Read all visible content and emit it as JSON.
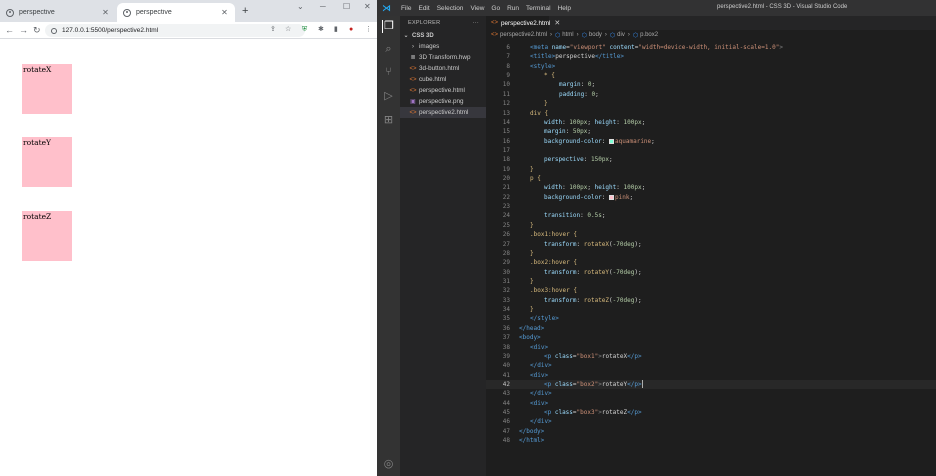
{
  "browser": {
    "tabs": [
      {
        "title": "perspective"
      },
      {
        "title": "perspective"
      }
    ],
    "new_tab": "+",
    "url": "127.0.0.1:5500/perspective2.html",
    "boxes": [
      {
        "label": "rotateX",
        "color": "#ffc0cb"
      },
      {
        "label": "rotateY",
        "color": "#ffc0cb"
      },
      {
        "label": "rotateZ",
        "color": "#ffc0cb"
      }
    ]
  },
  "vscode": {
    "menu": [
      "File",
      "Edit",
      "Selection",
      "View",
      "Go",
      "Run",
      "Terminal",
      "Help"
    ],
    "window_title": "perspective2.html - CSS 3D - Visual Studio Code",
    "explorer_title": "EXPLORER",
    "explorer_more": "···",
    "root_folder": "CSS 3D",
    "files": [
      {
        "name": "images",
        "icon": "folder-icon"
      },
      {
        "name": "3D Transform.hwp",
        "icon": "hwp-file-icon"
      },
      {
        "name": "3d-button.html",
        "icon": "html-file-icon"
      },
      {
        "name": "cube.html",
        "icon": "html-file-icon"
      },
      {
        "name": "perspective.html",
        "icon": "html-file-icon"
      },
      {
        "name": "perspective.png",
        "icon": "image-file-icon"
      },
      {
        "name": "perspective2.html",
        "icon": "html-file-icon"
      }
    ],
    "editor_tab": "perspective2.html",
    "breadcrumb": [
      "perspective2.html",
      "html",
      "body",
      "div",
      "p.box2"
    ],
    "current_line": 42,
    "code_lines": [
      {
        "n": "6"
      },
      {
        "n": "7"
      },
      {
        "n": "8"
      },
      {
        "n": "9"
      },
      {
        "n": "10"
      },
      {
        "n": "11"
      },
      {
        "n": "12"
      },
      {
        "n": "13"
      },
      {
        "n": "14"
      },
      {
        "n": "15"
      },
      {
        "n": "16"
      },
      {
        "n": "17"
      },
      {
        "n": "18"
      },
      {
        "n": "19"
      },
      {
        "n": "20"
      },
      {
        "n": "21"
      },
      {
        "n": "22"
      },
      {
        "n": "23"
      },
      {
        "n": "24"
      },
      {
        "n": "25"
      },
      {
        "n": "26"
      },
      {
        "n": "27"
      },
      {
        "n": "28"
      },
      {
        "n": "29"
      },
      {
        "n": "30"
      },
      {
        "n": "31"
      },
      {
        "n": "32"
      },
      {
        "n": "33"
      },
      {
        "n": "34"
      },
      {
        "n": "35"
      },
      {
        "n": "36"
      },
      {
        "n": "37"
      },
      {
        "n": "38"
      },
      {
        "n": "39"
      },
      {
        "n": "40"
      },
      {
        "n": "41"
      },
      {
        "n": "42"
      },
      {
        "n": "43"
      },
      {
        "n": "44"
      },
      {
        "n": "45"
      },
      {
        "n": "46"
      },
      {
        "n": "47"
      },
      {
        "n": "48"
      }
    ],
    "code": {
      "l6_a": "<meta ",
      "l6_b": "name",
      "l6_c": "=",
      "l6_d": "\"viewport\"",
      "l6_e": " content",
      "l6_f": "=",
      "l6_g": "\"width=device-width, initial-scale=1.0\"",
      "l6_h": ">",
      "l7_a": "<title>",
      "l7_b": "perspective",
      "l7_c": "</title>",
      "l8": "<style>",
      "l9": "* {",
      "l10_p": "margin",
      "l10_v": "0",
      "l11_p": "padding",
      "l11_v": "0",
      "l12": "}",
      "l13": "div {",
      "l14_p1": "width",
      "l14_v1": "100px",
      "l14_p2": "height",
      "l14_v2": "100px",
      "l15_p": "margin",
      "l15_v": "50px",
      "l16_p": "background-color",
      "l16_v": "aquamarine",
      "l16_c": "#7fffd4",
      "l18_p": "perspective",
      "l18_v": "150px",
      "l19": "}",
      "l20": "p {",
      "l21_p1": "width",
      "l21_v1": "100px",
      "l21_p2": "height",
      "l21_v2": "100px",
      "l22_p": "background-color",
      "l22_v": "pink",
      "l22_c": "#ffc0cb",
      "l24_p": "transition",
      "l24_v": "0.5s",
      "l25": "}",
      "l26": ".box1:hover {",
      "l27_p": "transform",
      "l27_f": "rotateX",
      "l27_v": "-70deg",
      "l28": "}",
      "l29": ".box2:hover {",
      "l30_p": "transform",
      "l30_f": "rotateY",
      "l30_v": "-70deg",
      "l31": "}",
      "l32": ".box3:hover {",
      "l33_p": "transform",
      "l33_f": "rotateZ",
      "l33_v": "-70deg",
      "l34": "}",
      "l35": "</style>",
      "l36": "</head>",
      "l37": "<body>",
      "l38": "<div>",
      "l39_a": "<p ",
      "l39_b": "class",
      "l39_c": "=",
      "l39_d": "\"box1\"",
      "l39_e": ">",
      "l39_f": "rotateX",
      "l39_g": "</p>",
      "l40": "</div>",
      "l41": "<div>",
      "l42_a": "<p ",
      "l42_b": "class",
      "l42_c": "=",
      "l42_d": "\"box2\"",
      "l42_e": ">",
      "l42_f": "rotateY",
      "l42_g": "</p>",
      "l43": "</div>",
      "l44": "<div>",
      "l45_a": "<p ",
      "l45_b": "class",
      "l45_c": "=",
      "l45_d": "\"box3\"",
      "l45_e": ">",
      "l45_f": "rotateZ",
      "l45_g": "</p>",
      "l46": "</div>",
      "l47": "</body>",
      "l48": "</html>"
    }
  }
}
